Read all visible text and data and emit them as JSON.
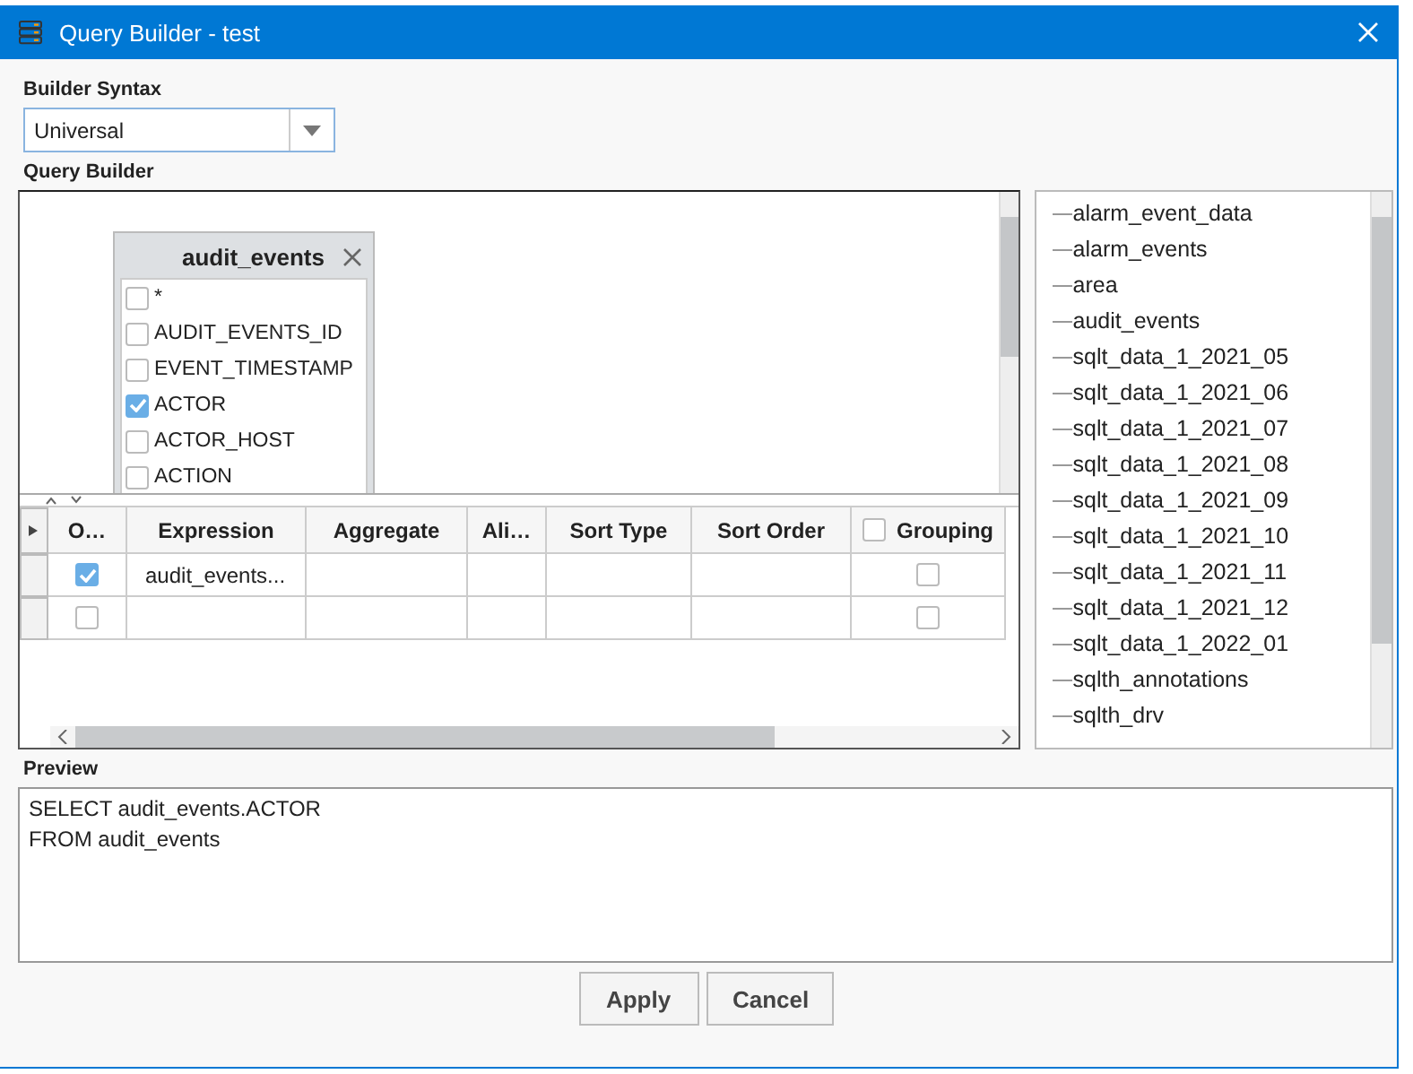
{
  "window": {
    "title": "Query Builder - test"
  },
  "builder_syntax": {
    "label": "Builder Syntax",
    "value": "Universal"
  },
  "query_builder": {
    "label": "Query Builder",
    "table_node": {
      "title": "audit_events",
      "fields": [
        {
          "name": "*",
          "checked": false
        },
        {
          "name": "AUDIT_EVENTS_ID",
          "checked": false
        },
        {
          "name": "EVENT_TIMESTAMP",
          "checked": false
        },
        {
          "name": "ACTOR",
          "checked": true
        },
        {
          "name": "ACTOR_HOST",
          "checked": false
        },
        {
          "name": "ACTION",
          "checked": false
        }
      ]
    },
    "grid": {
      "columns": [
        {
          "label": "O…"
        },
        {
          "label": "Expression"
        },
        {
          "label": "Aggregate"
        },
        {
          "label": "Ali…"
        },
        {
          "label": "Sort Type"
        },
        {
          "label": "Sort Order"
        },
        {
          "label": "Grouping",
          "checked": false
        }
      ],
      "rows": [
        {
          "output": true,
          "expression": "audit_events...",
          "grouping": false
        },
        {
          "output": false,
          "expression": "",
          "grouping": false
        }
      ]
    }
  },
  "tables": [
    "alarm_event_data",
    "alarm_events",
    "area",
    "audit_events",
    "sqlt_data_1_2021_05",
    "sqlt_data_1_2021_06",
    "sqlt_data_1_2021_07",
    "sqlt_data_1_2021_08",
    "sqlt_data_1_2021_09",
    "sqlt_data_1_2021_10",
    "sqlt_data_1_2021_11",
    "sqlt_data_1_2021_12",
    "sqlt_data_1_2022_01",
    "sqlth_annotations",
    "sqlth_drv"
  ],
  "preview": {
    "label": "Preview",
    "lines": [
      "SELECT audit_events.ACTOR",
      "FROM audit_events"
    ]
  },
  "buttons": [
    "Apply",
    "Cancel"
  ]
}
